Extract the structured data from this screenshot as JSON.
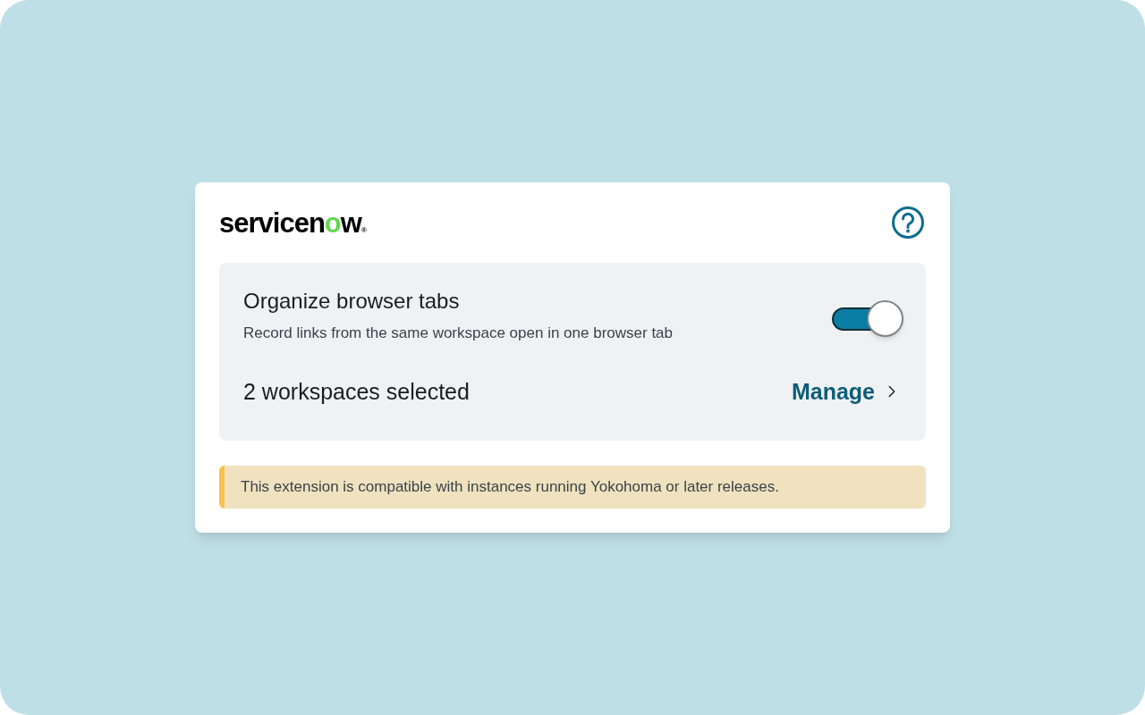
{
  "logo": {
    "text": "servicenow",
    "mark": "®"
  },
  "setting": {
    "title": "Organize browser tabs",
    "description": "Record links from the same workspace open in one browser tab",
    "on": true,
    "summary": "2 workspaces selected",
    "action": "Manage"
  },
  "notice": {
    "text": "This extension is compatible with instances running Yokohoma or later releases."
  }
}
